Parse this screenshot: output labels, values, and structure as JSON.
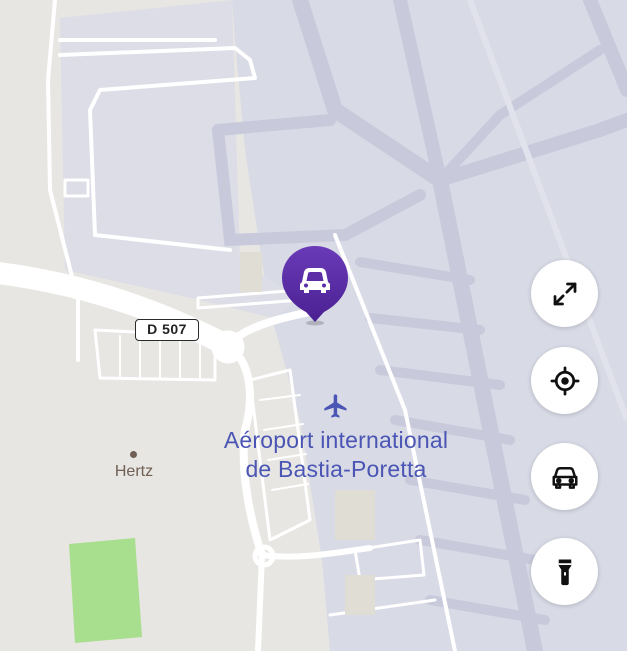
{
  "map": {
    "airport_label_line1": "Aéroport international",
    "airport_label_line2": "de Bastia-Poretta",
    "poi_label": "Hertz",
    "road_shield": "D 507",
    "colors": {
      "land": "#e7e6e3",
      "airport_area": "#d8dae6",
      "taxiway": "#c8cadc",
      "road": "#ffffff",
      "park": "#a8df8e",
      "airport_text": "#4a55b4",
      "marker": "#5b2ea8"
    }
  },
  "marker": {
    "icon": "car-icon",
    "kind": "parked-car-marker"
  },
  "controls": [
    {
      "name": "fullscreen-button",
      "icon": "expand-arrows-icon"
    },
    {
      "name": "locate-me-button",
      "icon": "crosshair-target-icon"
    },
    {
      "name": "car-button",
      "icon": "car-icon"
    },
    {
      "name": "flashlight-button",
      "icon": "flashlight-icon"
    }
  ]
}
